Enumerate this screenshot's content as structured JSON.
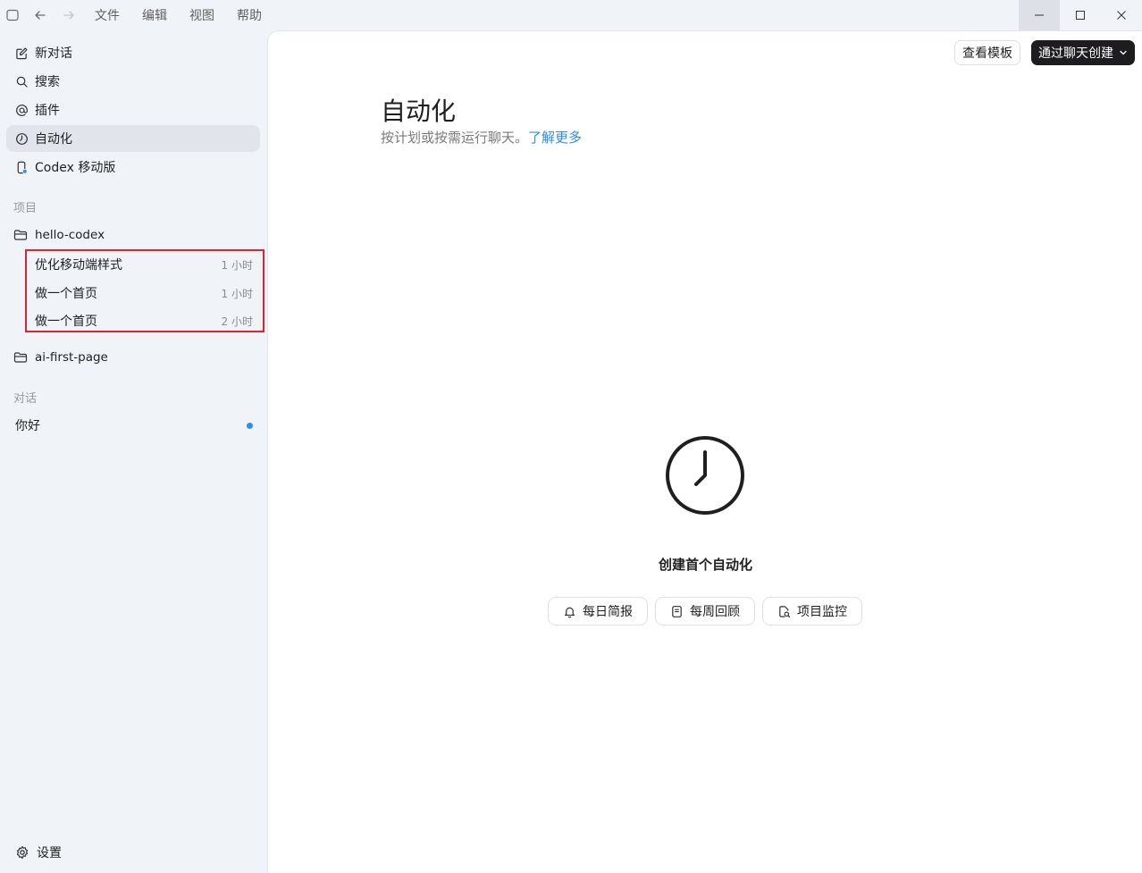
{
  "menu": {
    "file": "文件",
    "edit": "编辑",
    "view": "视图",
    "help": "帮助"
  },
  "sidebar": {
    "nav": [
      {
        "label": "新对话",
        "icon": "edit-icon"
      },
      {
        "label": "搜索",
        "icon": "search-icon"
      },
      {
        "label": "插件",
        "icon": "at-icon"
      },
      {
        "label": "自动化",
        "icon": "clock-icon",
        "active": true
      },
      {
        "label": "Codex 移动版",
        "icon": "phone-icon"
      }
    ],
    "projects_label": "项目",
    "projects": [
      {
        "name": "hello-codex",
        "threads": [
          {
            "title": "优化移动端样式",
            "time": "1 小时"
          },
          {
            "title": "做一个首页",
            "time": "1 小时"
          },
          {
            "title": "做一个首页",
            "time": "2 小时"
          }
        ]
      },
      {
        "name": "ai-first-page",
        "threads": []
      }
    ],
    "conversations_label": "对话",
    "conversations": [
      {
        "title": "你好",
        "unread": true
      }
    ],
    "settings_label": "设置"
  },
  "header": {
    "templates_button": "查看模板",
    "create_button": "通过聊天创建"
  },
  "main": {
    "title": "自动化",
    "subtitle": "按计划或按需运行聊天。",
    "learn_more": "了解更多",
    "empty_title": "创建首个自动化",
    "suggestions": [
      {
        "label": "每日简报",
        "icon": "bell-icon"
      },
      {
        "label": "每周回顾",
        "icon": "notebook-icon"
      },
      {
        "label": "项目监控",
        "icon": "file-search-icon"
      }
    ]
  },
  "colors": {
    "accent": "#2b8ef0",
    "highlight_border": "#e2222e",
    "sidebar_bg": "#f0f3f8",
    "primary_button": "#1d1d1f"
  }
}
